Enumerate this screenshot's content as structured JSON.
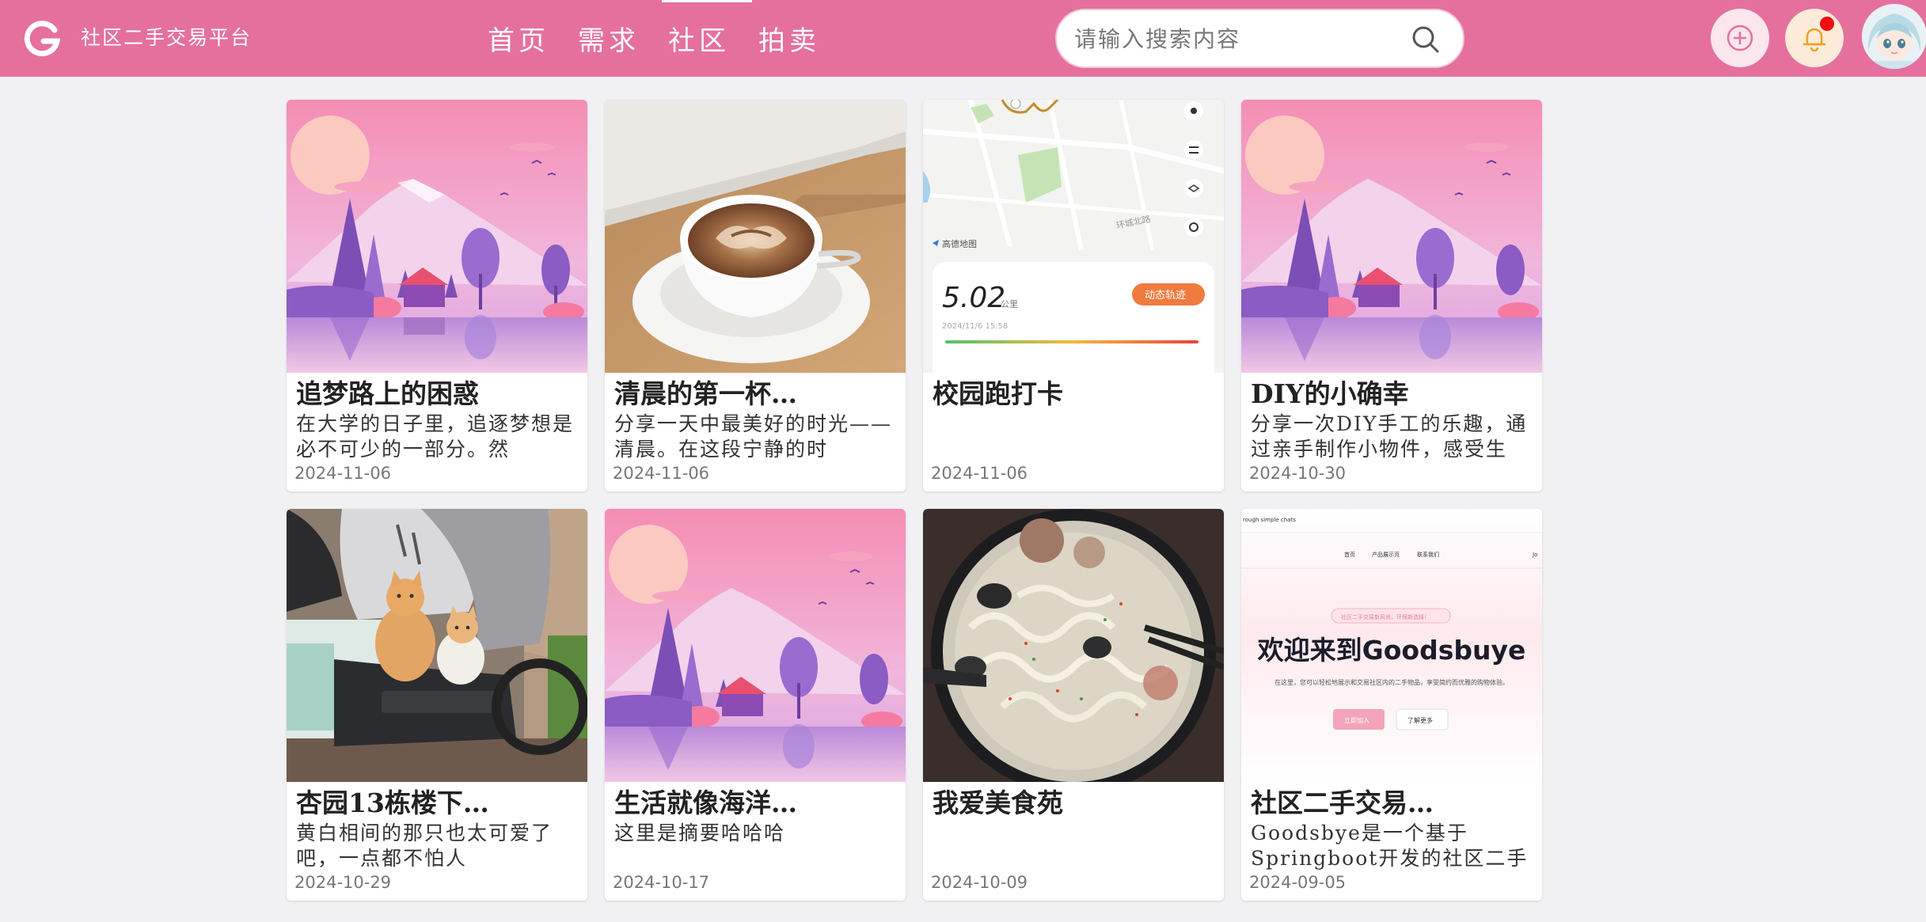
{
  "header": {
    "brand": "社区二手交易平台",
    "nav": [
      "首页",
      "需求",
      "社区",
      "拍卖"
    ],
    "active_nav": "社区",
    "search_placeholder": "请输入搜索内容",
    "accent_color": "#e5709e"
  },
  "posts": [
    {
      "title": "追梦路上的困惑",
      "summary": "在大学的日子里，追逐梦想是必不可少的一部分。然",
      "date": "2024-11-06",
      "image": "landscape-illustration"
    },
    {
      "title": "清晨的第一杯…",
      "summary": "分享一天中最美好的时光——清晨。在这段宁静的时",
      "date": "2024-11-06",
      "image": "coffee-photo"
    },
    {
      "title": "校园跑打卡",
      "summary": "",
      "date": "2024-11-06",
      "image": "run-map-screenshot",
      "image_texts": {
        "distance": "5.02",
        "unit": "公里",
        "badge": "动态轨迹",
        "time": "2024/11/6 15:58",
        "map_brand": "高德地图",
        "road": "环城北路"
      }
    },
    {
      "title": "DIY的小确幸",
      "summary": "分享一次DIY手工的乐趣，通过亲手制作小物件，感受生",
      "date": "2024-10-30",
      "image": "landscape-illustration"
    },
    {
      "title": "杏园13栋楼下…",
      "summary": "黄白相间的那只也太可爱了吧，一点都不怕人",
      "date": "2024-10-29",
      "image": "cats-photo"
    },
    {
      "title": "生活就像海洋…",
      "summary": "这里是摘要哈哈哈",
      "date": "2024-10-17",
      "image": "landscape-illustration"
    },
    {
      "title": "我爱美食苑",
      "summary": "",
      "date": "2024-10-09",
      "image": "noodles-photo"
    },
    {
      "title": "社区二手交易…",
      "summary": "Goodsbye是一个基于Springboot开发的社区二手",
      "date": "2024-09-05",
      "image": "website-screenshot",
      "image_texts": {
        "top": "rough simple chats",
        "nav": [
          "首页",
          "产品展示页",
          "联系我们"
        ],
        "nav_extra": "Jo",
        "pill": "社区二手交易新风尚，环保新选择！",
        "headline": "欢迎来到Goodsbuye",
        "sub": "在这里，您可以轻松地展示和交易社区内的二手物品，享受简约而优雅的购物体验。",
        "btn1": "立即加入",
        "btn2": "了解更多"
      }
    }
  ]
}
